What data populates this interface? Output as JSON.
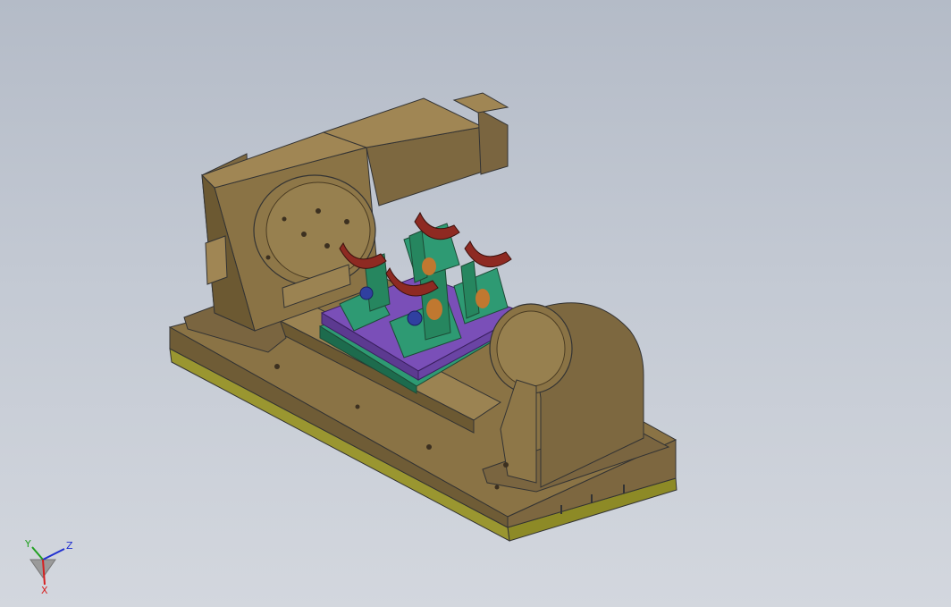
{
  "viewport": {
    "background_top": "#b4bbc7",
    "background_bottom": "#d3d7de"
  },
  "model": {
    "colors": {
      "body": "#8a7345",
      "body_dark": "#5e4c2b",
      "body_light": "#a88d58",
      "base_plate_side": "#8d8a26",
      "fixture_green": "#2e9a73",
      "fixture_dark": "#1d6b4d",
      "pallet_purple": "#7a4fb8",
      "clamp_red": "#8e2a22",
      "clamp_blue": "#3040a0"
    }
  },
  "triad": {
    "x_label": "X",
    "y_label": "Y",
    "z_label": "Z",
    "x_color": "#d62020",
    "y_color": "#20a020",
    "z_color": "#2030d0"
  }
}
